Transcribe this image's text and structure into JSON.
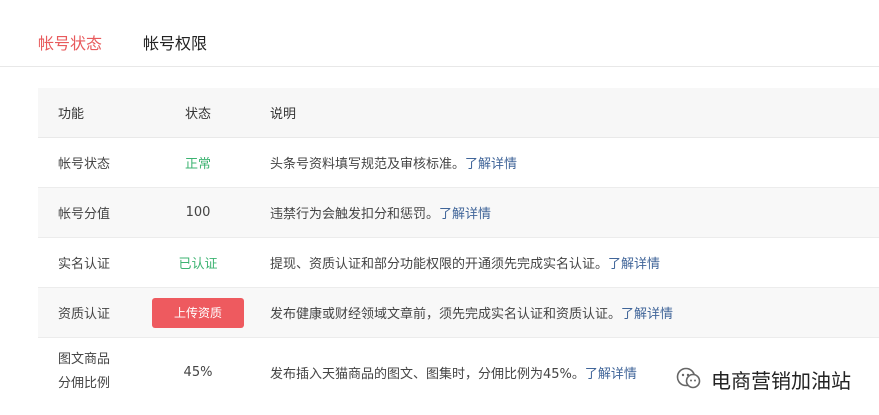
{
  "tabs": [
    {
      "label": "帐号状态",
      "active": true
    },
    {
      "label": "帐号权限",
      "active": false
    }
  ],
  "table": {
    "headers": {
      "function": "功能",
      "status": "状态",
      "description": "说明"
    },
    "rows": [
      {
        "function": "帐号状态",
        "status": "正常",
        "description": "头条号资料填写规范及审核标准。",
        "link": "了解详情"
      },
      {
        "function": "帐号分值",
        "status": "100",
        "description": "违禁行为会触发扣分和惩罚。",
        "link": "了解详情"
      },
      {
        "function": "实名认证",
        "status": "已认证",
        "description": "提现、资质认证和部分功能权限的开通须先完成实名认证。",
        "link": "了解详情"
      },
      {
        "function": "资质认证",
        "status": "上传资质",
        "description": "发布健康或财经领域文章前，须先完成实名认证和资质认证。",
        "link": "了解详情"
      },
      {
        "function_line1": "图文商品",
        "function_line2": "分佣比例",
        "status": "45%",
        "description": "发布插入天猫商品的图文、图集时，分佣比例为45%。",
        "link": "了解详情"
      }
    ]
  },
  "colors": {
    "accent": "#e85a5c",
    "success": "#3cb371",
    "link": "#406599",
    "button": "#ee5a5f"
  },
  "watermark": {
    "text": "电商营销加油站",
    "icon": "wechat-icon"
  }
}
